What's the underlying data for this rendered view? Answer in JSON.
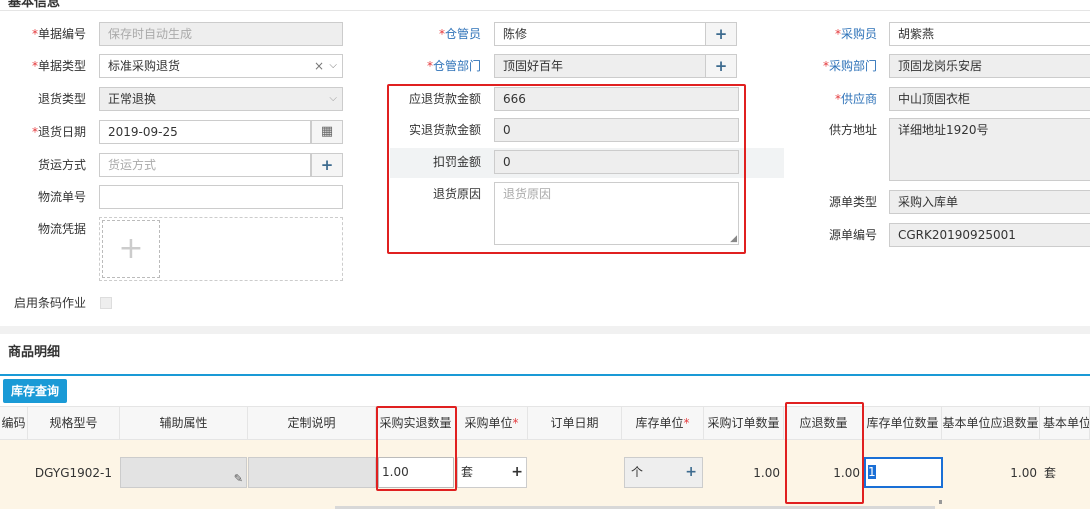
{
  "header": {
    "section_title": "基本信息"
  },
  "form": {
    "doc_no": {
      "label": "单据编号",
      "placeholder": "保存时自动生成"
    },
    "doc_type": {
      "label": "单据类型",
      "value": "标准采购退货"
    },
    "return_type": {
      "label": "退货类型",
      "value": "正常退换"
    },
    "return_date": {
      "label": "退货日期",
      "value": "2019-09-25"
    },
    "shipping": {
      "label": "货运方式",
      "placeholder": "货运方式"
    },
    "tracking_no": {
      "label": "物流单号",
      "value": ""
    },
    "voucher": {
      "label": "物流凭据"
    },
    "barcode": {
      "label": "启用条码作业"
    },
    "keeper": {
      "label": "仓管员",
      "value": "陈修"
    },
    "keeper_dept": {
      "label": "仓管部门",
      "value": "顶固好百年"
    },
    "should_amount": {
      "label": "应退货款金额",
      "value": "666"
    },
    "actual_amount": {
      "label": "实退货款金额",
      "value": "0"
    },
    "penalty": {
      "label": "扣罚金额",
      "value": "0"
    },
    "reason": {
      "label": "退货原因",
      "placeholder": "退货原因"
    },
    "buyer": {
      "label": "采购员",
      "value": "胡紫燕"
    },
    "buyer_dept": {
      "label": "采购部门",
      "value": "顶固龙岗乐安居"
    },
    "supplier": {
      "label": "供应商",
      "value": "中山顶固衣柜"
    },
    "supplier_addr": {
      "label": "供方地址",
      "value": "详细地址1920号"
    },
    "source_type": {
      "label": "源单类型",
      "value": "采购入库单"
    },
    "source_no": {
      "label": "源单编号",
      "value": "CGRK20190925001"
    }
  },
  "detail": {
    "section_title": "商品明细",
    "stock_query_button": "库存查询",
    "columns": {
      "code": "编码",
      "spec": "规格型号",
      "aux": "辅助属性",
      "custom": "定制说明",
      "actual_qty": "采购实退数量",
      "purchase_unit": "采购单位",
      "order_date": "订单日期",
      "stock_unit": "库存单位",
      "order_qty": "采购订单数量",
      "should_qty": "应退数量",
      "stock_unit_qty": "库存单位数量",
      "base_should_qty": "基本单位应退数量",
      "base_unit": "基本单位"
    },
    "row": {
      "spec": "DGYG1902-1",
      "actual_qty": "1.00",
      "purchase_unit": "套",
      "stock_unit": "个",
      "order_qty": "1.00",
      "should_qty": "1.00",
      "stock_unit_qty": "1",
      "base_should_qty": "1.00",
      "base_unit": "套"
    }
  },
  "colors": {
    "accent": "#1a9ad6",
    "required": "#e4393c",
    "highlight_border": "#e02020",
    "row_bg": "#fdf5e6"
  }
}
